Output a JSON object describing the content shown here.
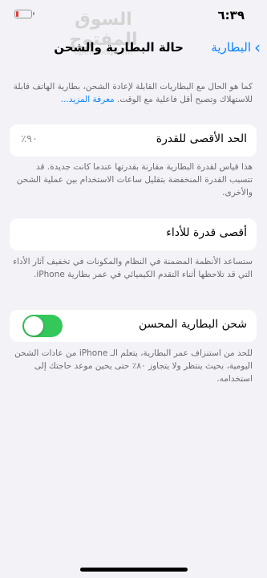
{
  "status": {
    "time": "٦:٣٩"
  },
  "watermark": {
    "arabic": "السوق المفتوح",
    "latin": "opensooq.com"
  },
  "nav": {
    "back_label": "البطارية",
    "title": "حالة البطارية والشحن"
  },
  "intro": {
    "text": "كما هو الحال مع البطاريات القابلة لإعادة الشحن، بطارية الهاتف قابلة للاستهلاك وتصبح أقل فاعلية مع الوقت.",
    "link": "معرفة المزيد..."
  },
  "max_capacity": {
    "label": "الحد الأقصى للقدرة",
    "value": "٩٠٪",
    "description": "هذا قياس لقدرة البطارية مقارنة بقدرتها عندما كانت جديدة. قد تتسبب القدرة المنخفضة بتقليل ساعات الاستخدام بين عملية الشحن والأخرى."
  },
  "peak_performance": {
    "label": "أقصى قدرة للأداء",
    "description": "ستساعد الأنظمة المضمنة في النظام والمكونات في تخفيف آثار الأداء التي قد تلاحظها أثناء التقدم الكيميائي في عمر بطارية iPhone."
  },
  "optimized_charging": {
    "label": "شحن البطارية المحسن",
    "enabled": true,
    "description": "للحد من استنزاف عمر البطارية، يتعلم الـ iPhone من عادات الشحن اليومية، بحيث ينتظر ولا يتجاوز ٨٠٪ حتى يحين موعد حاجتك إلى استخدامه."
  },
  "colors": {
    "accent": "#0a84ff",
    "toggle_on": "#34c759",
    "background": "#f2f2f7"
  }
}
